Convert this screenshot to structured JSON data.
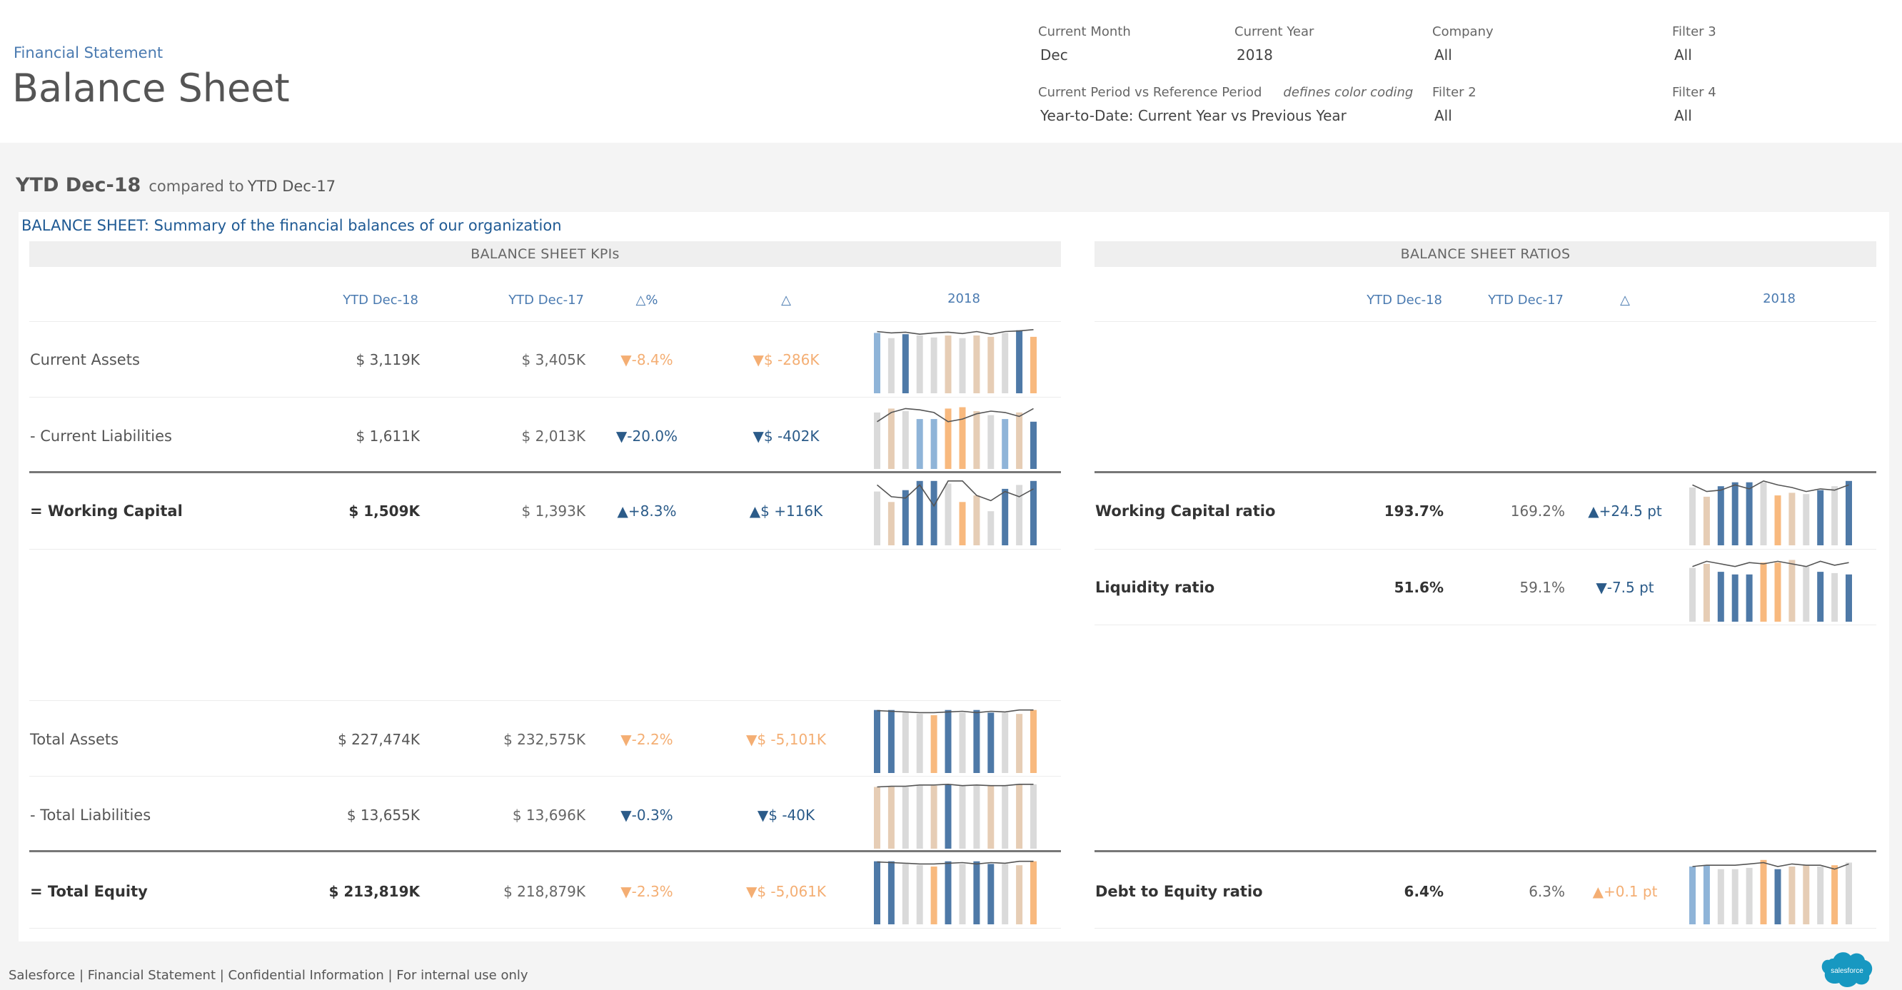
{
  "header": {
    "breadcrumb": "Financial Statement",
    "title": "Balance Sheet"
  },
  "filters": {
    "current_month": {
      "label": "Current Month",
      "value": "Dec"
    },
    "current_year": {
      "label": "Current Year",
      "value": "2018"
    },
    "company": {
      "label": "Company",
      "value": "All"
    },
    "filter3": {
      "label": "Filter 3",
      "value": "All"
    },
    "period": {
      "label": "Current Period vs Reference Period",
      "note": "defines color coding",
      "value": "Year-to-Date: Current Year vs Previous Year"
    },
    "filter2": {
      "label": "Filter 2",
      "value": "All"
    },
    "filter4": {
      "label": "Filter 4",
      "value": "All"
    }
  },
  "period_title": {
    "current": "YTD Dec-18",
    "compared_to": "compared to",
    "reference": "YTD Dec-17"
  },
  "panel": {
    "title": "BALANCE SHEET: Summary of the financial balances of our organization"
  },
  "colors": {
    "dark_blue": "#4e79a7",
    "light_blue": "#8fb4d8",
    "orange": "#f8b97e",
    "peach": "#e6cdb5",
    "grey": "#dadada",
    "line": "#555555",
    "positive_text": "#2b5b89",
    "negative_text": "#f4ae73"
  },
  "kpis": {
    "section_title": "BALANCE SHEET KPIs",
    "columns": {
      "current": "YTD Dec-18",
      "reference": "YTD Dec-17",
      "delta_pct": "△%",
      "delta": "△",
      "trend": "2018"
    },
    "rows": [
      {
        "name": "Current Assets",
        "current": "$ 3,119K",
        "reference": "$ 3,405K",
        "delta_pct": "▼-8.4%",
        "delta": "▼$ -286K",
        "status": "bad",
        "trend": {
          "bars": [
            92,
            84,
            90,
            88,
            85,
            88,
            84,
            88,
            86,
            92,
            96,
            86
          ],
          "colors": [
            "light_blue",
            "grey",
            "dark_blue",
            "grey",
            "grey",
            "peach",
            "grey",
            "peach",
            "peach",
            "grey",
            "dark_blue",
            "orange"
          ],
          "line": [
            94,
            92,
            93,
            90,
            92,
            93,
            91,
            94,
            90,
            94,
            95,
            97
          ]
        }
      },
      {
        "name": "- Current Liabilities",
        "current": "$ 1,611K",
        "reference": "$ 2,013K",
        "delta_pct": "▼-20.0%",
        "delta": "▼$ -402K",
        "status": "good",
        "trend": {
          "bars": [
            86,
            92,
            88,
            76,
            76,
            92,
            94,
            88,
            82,
            76,
            86,
            72
          ],
          "colors": [
            "grey",
            "peach",
            "grey",
            "light_blue",
            "light_blue",
            "orange",
            "orange",
            "peach",
            "grey",
            "light_blue",
            "peach",
            "dark_blue"
          ],
          "line": [
            72,
            86,
            92,
            90,
            86,
            72,
            76,
            84,
            88,
            86,
            80,
            92
          ]
        }
      },
      {
        "name": "= Working Capital",
        "current": "$ 1,509K",
        "reference": "$ 1,393K",
        "delta_pct": "▲+8.3%",
        "delta": "▲$ +116K",
        "status": "good",
        "bold": true,
        "trend": {
          "bars": [
            82,
            66,
            84,
            98,
            98,
            94,
            66,
            76,
            52,
            86,
            92,
            98
          ],
          "colors": [
            "grey",
            "peach",
            "dark_blue",
            "dark_blue",
            "dark_blue",
            "grey",
            "orange",
            "peach",
            "grey",
            "dark_blue",
            "grey",
            "dark_blue"
          ],
          "line": [
            92,
            74,
            72,
            92,
            60,
            98,
            98,
            76,
            68,
            82,
            74,
            86
          ]
        }
      },
      {
        "name": "Total Assets",
        "current": "$ 227,474K",
        "reference": "$ 232,575K",
        "delta_pct": "▼-2.2%",
        "delta": "▼$ -5,101K",
        "status": "bad",
        "trend": {
          "bars": [
            96,
            96,
            92,
            90,
            88,
            96,
            92,
            96,
            92,
            92,
            90,
            96
          ],
          "colors": [
            "dark_blue",
            "dark_blue",
            "grey",
            "grey",
            "orange",
            "dark_blue",
            "grey",
            "dark_blue",
            "dark_blue",
            "grey",
            "peach",
            "orange"
          ],
          "line": [
            95,
            94,
            93,
            92,
            92,
            93,
            94,
            92,
            94,
            93,
            96,
            96
          ]
        }
      },
      {
        "name": "- Total Liabilities",
        "current": "$ 13,655K",
        "reference": "$ 13,696K",
        "delta_pct": "▼-0.3%",
        "delta": "▼$ -40K",
        "status": "good",
        "trend": {
          "bars": [
            94,
            94,
            94,
            96,
            96,
            98,
            96,
            96,
            96,
            96,
            98,
            98
          ],
          "colors": [
            "peach",
            "peach",
            "grey",
            "grey",
            "peach",
            "dark_blue",
            "grey",
            "grey",
            "peach",
            "grey",
            "peach",
            "grey"
          ],
          "line": [
            94,
            95,
            95,
            97,
            97,
            98,
            96,
            97,
            96,
            96,
            98,
            98
          ]
        }
      },
      {
        "name": "= Total Equity",
        "current": "$ 213,819K",
        "reference": "$ 218,879K",
        "delta_pct": "▼-2.3%",
        "delta": "▼$ -5,061K",
        "status": "bad",
        "bold": true,
        "trend": {
          "bars": [
            96,
            96,
            92,
            90,
            88,
            96,
            92,
            96,
            92,
            92,
            90,
            96
          ],
          "colors": [
            "dark_blue",
            "dark_blue",
            "grey",
            "grey",
            "orange",
            "dark_blue",
            "grey",
            "dark_blue",
            "dark_blue",
            "grey",
            "peach",
            "orange"
          ],
          "line": [
            95,
            94,
            93,
            92,
            92,
            93,
            94,
            92,
            94,
            93,
            96,
            96
          ]
        }
      }
    ]
  },
  "ratios": {
    "section_title": "BALANCE SHEET RATIOS",
    "columns": {
      "current": "YTD Dec-18",
      "reference": "YTD Dec-17",
      "delta": "△",
      "trend": "2018"
    },
    "rows": [
      {
        "name": "Working Capital ratio",
        "current": "193.7%",
        "reference": "169.2%",
        "delta": "▲+24.5 pt",
        "status": "good",
        "trend": {
          "bars": [
            88,
            74,
            90,
            96,
            96,
            96,
            76,
            80,
            78,
            84,
            90,
            98
          ],
          "colors": [
            "grey",
            "peach",
            "dark_blue",
            "dark_blue",
            "dark_blue",
            "grey",
            "orange",
            "peach",
            "grey",
            "dark_blue",
            "grey",
            "dark_blue"
          ],
          "line": [
            92,
            82,
            84,
            92,
            86,
            98,
            92,
            88,
            82,
            86,
            84,
            92
          ]
        }
      },
      {
        "name": "Liquidity ratio",
        "current": "51.6%",
        "reference": "59.1%",
        "delta": "▼-7.5 pt",
        "status": "good",
        "trend": {
          "bars": [
            82,
            88,
            76,
            72,
            72,
            90,
            90,
            94,
            84,
            76,
            74,
            72
          ],
          "colors": [
            "grey",
            "peach",
            "dark_blue",
            "dark_blue",
            "dark_blue",
            "orange",
            "orange",
            "peach",
            "grey",
            "dark_blue",
            "grey",
            "dark_blue"
          ],
          "line": [
            84,
            92,
            88,
            84,
            90,
            88,
            92,
            88,
            84,
            92,
            86,
            90
          ]
        }
      },
      {
        "name": "Debt to Equity ratio",
        "current": "6.4%",
        "reference": "6.3%",
        "delta": "▲+0.1 pt",
        "status": "bad",
        "trend": {
          "bars": [
            88,
            90,
            84,
            84,
            86,
            98,
            84,
            88,
            90,
            88,
            90,
            94
          ],
          "colors": [
            "light_blue",
            "light_blue",
            "grey",
            "grey",
            "grey",
            "orange",
            "dark_blue",
            "peach",
            "peach",
            "grey",
            "orange",
            "grey"
          ],
          "line": [
            88,
            90,
            90,
            90,
            92,
            94,
            88,
            92,
            90,
            90,
            84,
            92
          ]
        }
      }
    ]
  },
  "footer": {
    "text": "Salesforce | Financial Statement | Confidential Information | For internal use only",
    "logo_text": "salesforce"
  }
}
